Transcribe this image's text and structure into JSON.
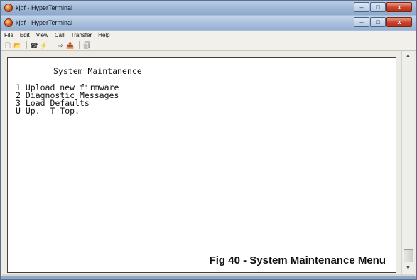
{
  "back_window": {
    "title": "kjgf - HyperTerminal"
  },
  "window": {
    "title": "kjgf - HyperTerminal",
    "controls": {
      "minimize": "–",
      "maximize": "□",
      "close": "x"
    }
  },
  "menu": [
    "File",
    "Edit",
    "View",
    "Call",
    "Transfer",
    "Help"
  ],
  "toolbar": {
    "buttons": [
      {
        "name": "new-icon",
        "glyph": "🗋"
      },
      {
        "name": "open-icon",
        "glyph": "📂"
      },
      {
        "name": "connect-icon",
        "glyph": "☎"
      },
      {
        "name": "disconnect-icon",
        "glyph": "⚡"
      },
      {
        "name": "send-icon",
        "glyph": "⇨"
      },
      {
        "name": "receive-icon",
        "glyph": "📥"
      },
      {
        "name": "properties-icon",
        "glyph": "🗐"
      }
    ]
  },
  "terminal": {
    "title": "System Maintanence",
    "lines": [
      "1 Upload new firmware",
      "2 Diagnostic Messages",
      "3 Load Defaults",
      "U Up.  T Top."
    ]
  },
  "caption": "Fig 40 - System Maintenance Menu"
}
